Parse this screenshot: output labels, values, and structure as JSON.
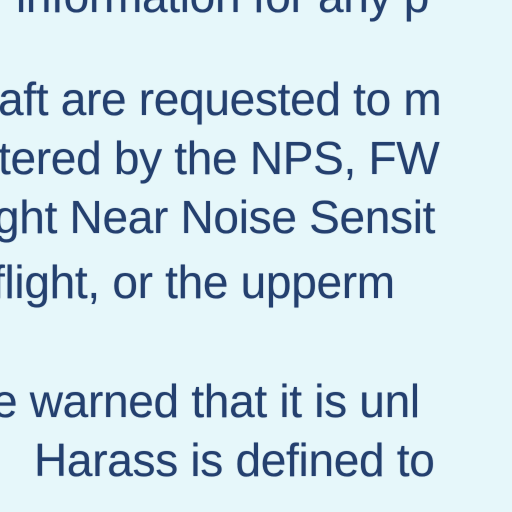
{
  "document": {
    "background_color": "#e6f7fa",
    "text_color": "#24406f",
    "lines": [
      "information for any p",
      "aft are requested to m",
      "tered by the NPS, FW",
      "ght Near Noise Sensit",
      "flight, or the upperm",
      "e warned that it is unl",
      "Harass is defined to"
    ]
  }
}
